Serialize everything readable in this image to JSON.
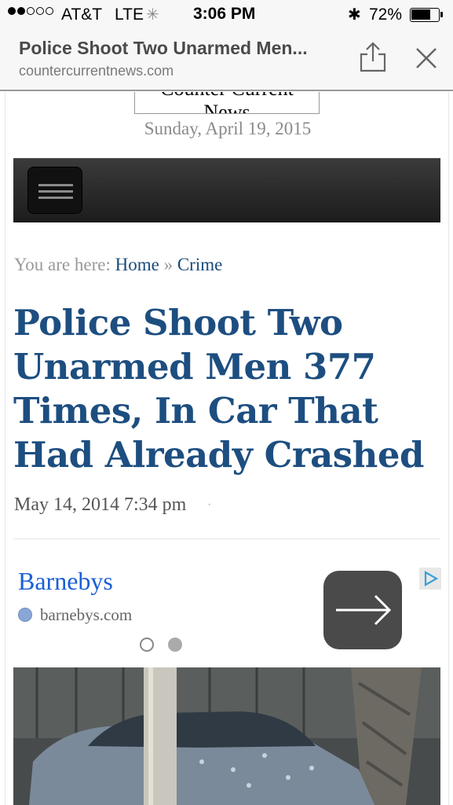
{
  "status_bar": {
    "carrier": "AT&T",
    "network": "LTE",
    "time": "3:06 PM",
    "battery_percent": "72%",
    "battery_level": 0.72
  },
  "browser": {
    "page_title": "Police Shoot Two Unarmed Men...",
    "url": "countercurrentnews.com"
  },
  "site": {
    "logo_text": "Counter Current News",
    "date": "Sunday, April 19, 2015"
  },
  "breadcrumb": {
    "prefix": "You are here:",
    "home": "Home",
    "separator": "»",
    "category": "Crime"
  },
  "article": {
    "headline": "Police Shoot Two Unarmed Men 377 Times, In Car That Had Already Crashed",
    "meta": "May 14, 2014 7:34 pm",
    "meta_dot": "·"
  },
  "ad": {
    "title": "Barnebys",
    "url": "barnebys.com",
    "pages": 2,
    "active_page": 2
  },
  "colors": {
    "headline": "#1d4e80",
    "link": "#1a4a7a",
    "ad_title": "#1a5fd6",
    "navbar": "#2a2a2a"
  }
}
